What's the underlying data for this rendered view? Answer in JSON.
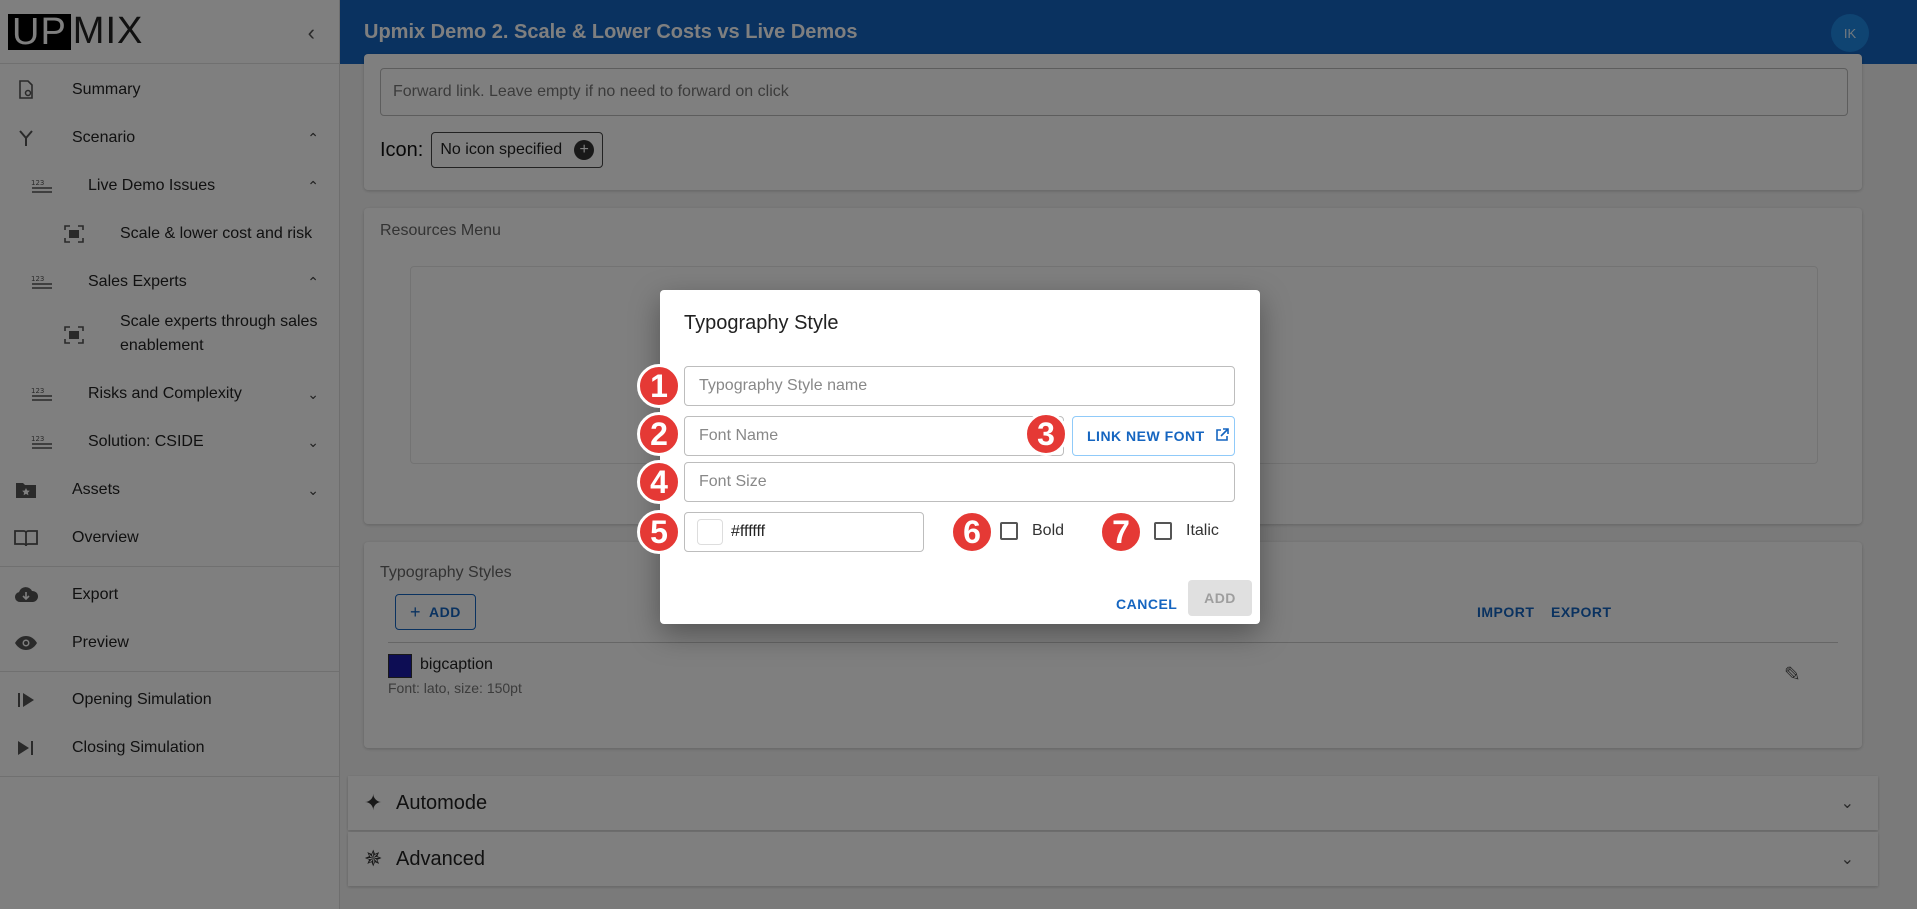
{
  "sidebar": {
    "logo_up": "UP",
    "logo_mix": "MIX",
    "items": [
      {
        "label": "Summary",
        "icon": "document-gear-icon"
      },
      {
        "label": "Scenario",
        "icon": "fork-icon",
        "chevron": "up"
      },
      {
        "label": "Live Demo Issues",
        "icon": "numbered-list-icon",
        "chevron": "up"
      },
      {
        "label": "Scale & lower cost and risk",
        "icon": "frame-icon"
      },
      {
        "label": "Sales Experts",
        "icon": "numbered-list-icon",
        "chevron": "up"
      },
      {
        "label_line1": "Scale experts through sales",
        "label_line2": "enablement",
        "icon": "frame-icon"
      },
      {
        "label": "Risks and Complexity",
        "icon": "numbered-list-icon",
        "chevron": "down"
      },
      {
        "label": "Solution: CSIDE",
        "icon": "numbered-list-icon",
        "chevron": "down"
      },
      {
        "label": "Assets",
        "icon": "folder-star-icon",
        "chevron": "down"
      },
      {
        "label": "Overview",
        "icon": "book-icon"
      },
      {
        "label": "Export",
        "icon": "cloud-download-icon"
      },
      {
        "label": "Preview",
        "icon": "eye-icon"
      },
      {
        "label": "Opening Simulation",
        "icon": "play-start-icon"
      },
      {
        "label": "Closing Simulation",
        "icon": "skip-end-icon"
      }
    ]
  },
  "header": {
    "title": "Upmix Demo 2. Scale & Lower Costs vs Live Demos",
    "avatar": "IK",
    "color": "#1565c0"
  },
  "main": {
    "forward_link_placeholder": "Forward link. Leave empty if no need to forward on click",
    "icon_label": "Icon:",
    "icon_value": "No icon specified",
    "resources_title": "Resources Menu",
    "typography_title": "Typography Styles",
    "add_label": "ADD",
    "import_label": "IMPORT",
    "export_label": "EXPORT",
    "style": {
      "name": "bigcaption",
      "desc": "Font: lato, size: 150pt",
      "color": "#1a1aa8"
    },
    "automode": "Automode",
    "advanced": "Advanced"
  },
  "dialog": {
    "title": "Typography Style",
    "style_name_placeholder": "Typography Style name",
    "font_name_placeholder": "Font Name",
    "link_font_label": "LINK NEW FONT",
    "font_size_placeholder": "Font Size",
    "color_value": "#ffffff",
    "bold_label": "Bold",
    "italic_label": "Italic",
    "cancel_label": "CANCEL",
    "add_label": "ADD"
  },
  "markers": [
    "1",
    "2",
    "3",
    "4",
    "5",
    "6",
    "7"
  ],
  "colors": {
    "accent": "#1565c0",
    "marker": "#e53935"
  }
}
